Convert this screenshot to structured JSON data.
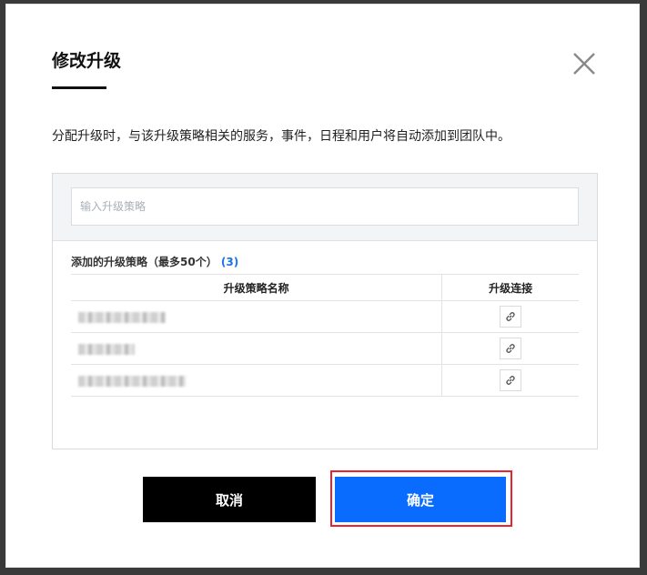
{
  "dialog": {
    "title": "修改升级",
    "description": "分配升级时，与该升级策略相关的服务，事件，日程和用户将自动添加到团队中。",
    "search": {
      "placeholder": "输入升级策略",
      "value": ""
    },
    "added": {
      "label": "添加的升级策略（最多50个）",
      "count_open": "(",
      "count": "3",
      "count_close": ")"
    },
    "table": {
      "headers": {
        "name": "升级策略名称",
        "link": "升级连接"
      },
      "rows": [
        {
          "name_redacted": true,
          "link_icon": "link-icon"
        },
        {
          "name_redacted": true,
          "link_icon": "link-icon"
        },
        {
          "name_redacted": true,
          "link_icon": "link-icon"
        }
      ]
    },
    "buttons": {
      "cancel": "取消",
      "confirm": "确定"
    },
    "icons": {
      "close": "close-icon",
      "link": "link-icon"
    },
    "colors": {
      "primary": "#0a6cff",
      "cancel": "#000000",
      "highlight": "#e8242e",
      "count": "#1a73e8"
    }
  }
}
